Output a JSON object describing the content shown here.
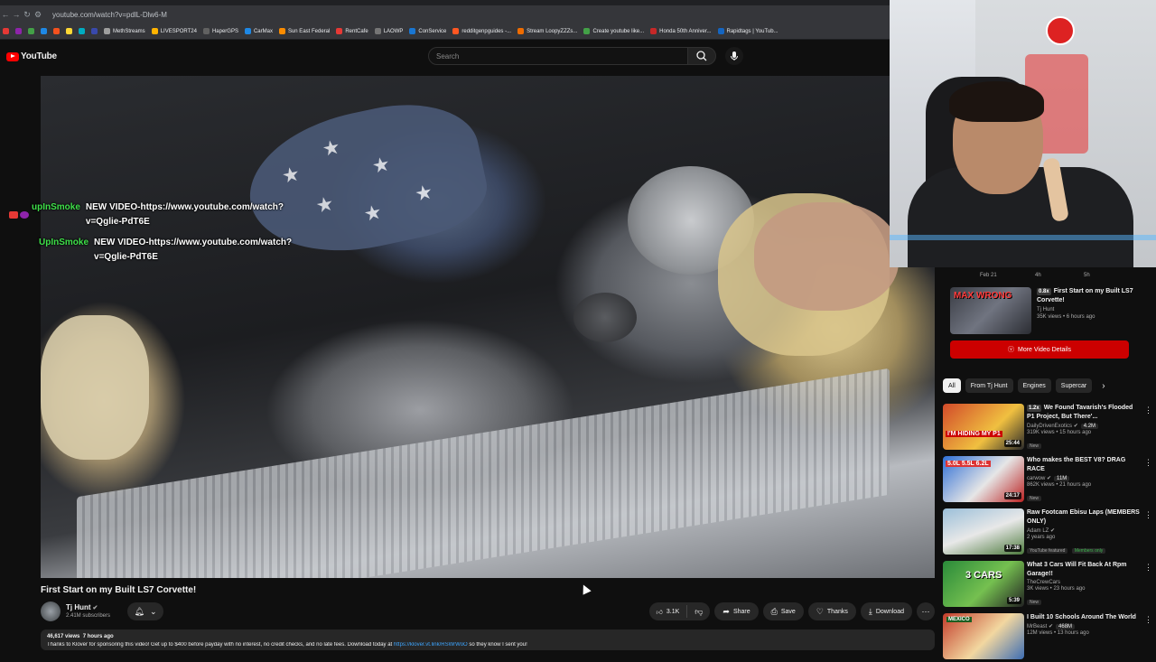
{
  "browser": {
    "url": "youtube.com/watch?v=pdlL-Dlw6-M",
    "bookmarks": [
      "MethStreams",
      "LIVESPORT24",
      "HaperGPS",
      "CarMax",
      "Sun East Federal",
      "RentCafe",
      "LAOWP",
      "ConService",
      "redditgenpguides -...",
      "Stream LoopyZZZs...",
      "Create youtube like...",
      "Honda 50th Anniver...",
      "Rapidtags | YouTub..."
    ]
  },
  "header": {
    "logo_text": "YouTube",
    "search_placeholder": "Search"
  },
  "chat": {
    "line1": {
      "user": "upInSmoke",
      "message": "NEW VIDEO-https://www.youtube.com/watch?v=Qglie-PdT6E"
    },
    "line2": {
      "user": "UpInSmoke",
      "message": "NEW VIDEO-https://www.youtube.com/watch?v=Qglie-PdT6E"
    }
  },
  "video": {
    "title": "First Start on my Built LS7 Corvette!",
    "channel": "Tj Hunt",
    "subscribers": "2.41M subscribers",
    "likes": "3.1K",
    "share": "Share",
    "save": "Save",
    "thanks": "Thanks",
    "download": "Download",
    "views": "46,617 views",
    "age": "7 hours ago",
    "description": "Thanks to Klover for sponsoring this video! Get up to $400 before payday with no interest, no credit checks, and no late fees. Download today at",
    "description_link": "https://klover.vt.link/RSWrWoO",
    "description_tail": "so they know I sent you!"
  },
  "sidebar": {
    "chart_labels": [
      "Feb 21",
      "4h",
      "5h"
    ],
    "hero": {
      "thumb_text": "MAX WRONG",
      "speed": "0.8x",
      "title": "First Start on my Built LS7 Corvette!",
      "channel": "Tj Hunt",
      "meta": "35K views • 6 hours ago"
    },
    "more_button": "More Video Details",
    "chips": [
      "All",
      "From Tj Hunt",
      "Engines",
      "Supercar"
    ],
    "recs": [
      {
        "speed": "1.2x",
        "title": "We Found Tavarish's Flooded P1 Project, But There'...",
        "channel": "DailyDrivenExotics",
        "badge": "4.2M",
        "meta": "319K views • 15 hours ago",
        "tag": "New",
        "duration": "25:44",
        "thumb_text": "I'M HIDING MY P1"
      },
      {
        "title": "Who makes the BEST V8? DRAG RACE",
        "channel": "carwow",
        "badge": "11M",
        "meta": "862K views • 21 hours ago",
        "tag": "New",
        "duration": "24:17",
        "thumb_text": "5.0L 5.5L 6.2L"
      },
      {
        "title": "Raw Footcam Ebisu Laps (MEMBERS ONLY)",
        "channel": "Adam LZ",
        "meta": "2 years ago",
        "tag": "YouTube featured",
        "tag2": "Members only",
        "duration": "17:38",
        "thumb_text": ""
      },
      {
        "title": "What 3 Cars Will Fit Back At Rpm Garage!!",
        "channel": "TheCrewCars",
        "meta": "3K views • 23 hours ago",
        "tag": "New",
        "duration": "5:39",
        "thumb_text": "3 CARS"
      },
      {
        "title": "I Built 10 Schools Around The World",
        "channel": "MrBeast",
        "badge": "468M",
        "meta": "12M views • 13 hours ago",
        "tag": "",
        "duration": "",
        "thumb_text": "MEXICO"
      }
    ]
  },
  "colors": {
    "accent": "#ff0000",
    "chat_user": "#3fe04a",
    "link": "#3ea6ff"
  }
}
